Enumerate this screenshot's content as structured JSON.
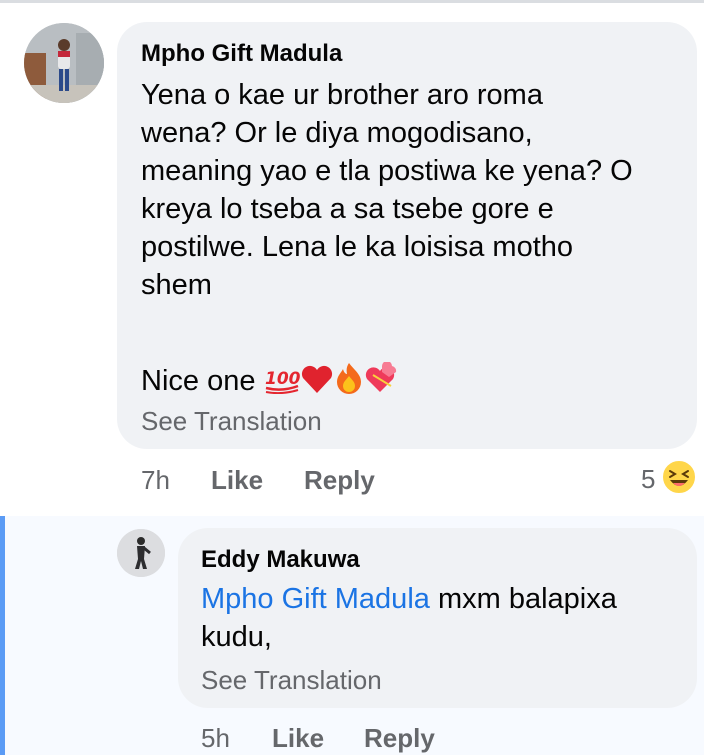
{
  "comment": {
    "author": "Mpho Gift Madula",
    "lines": [
      "Yena o kae ur brother aro roma",
      "wena? Or le diya mogodisano,",
      "meaning yao e tla postiwa ke yena? O",
      "kreya lo tseba a sa tsebe gore e",
      "postilwe. Lena le ka loisisa motho",
      "shem"
    ],
    "closing_text": "Nice one",
    "emojis": [
      "100",
      "red-heart",
      "fire",
      "heart-with-ribbon"
    ],
    "see_translation": "See Translation",
    "time": "7h",
    "like": "Like",
    "reply": "Reply",
    "reaction_count": "5",
    "reaction_icon": "laughing-face-icon"
  },
  "reply": {
    "author": "Eddy Makuwa",
    "mention": "Mpho Gift Madula",
    "text_after_mention": " mxm balapixa",
    "line2": "kudu,",
    "see_translation": "See Translation",
    "time": "5h",
    "like": "Like",
    "reply": "Reply"
  },
  "colors": {
    "bubble": "#f0f2f5",
    "mention": "#1b74e4",
    "meta": "#65676b",
    "highlight_bar": "#5b9bf5"
  }
}
